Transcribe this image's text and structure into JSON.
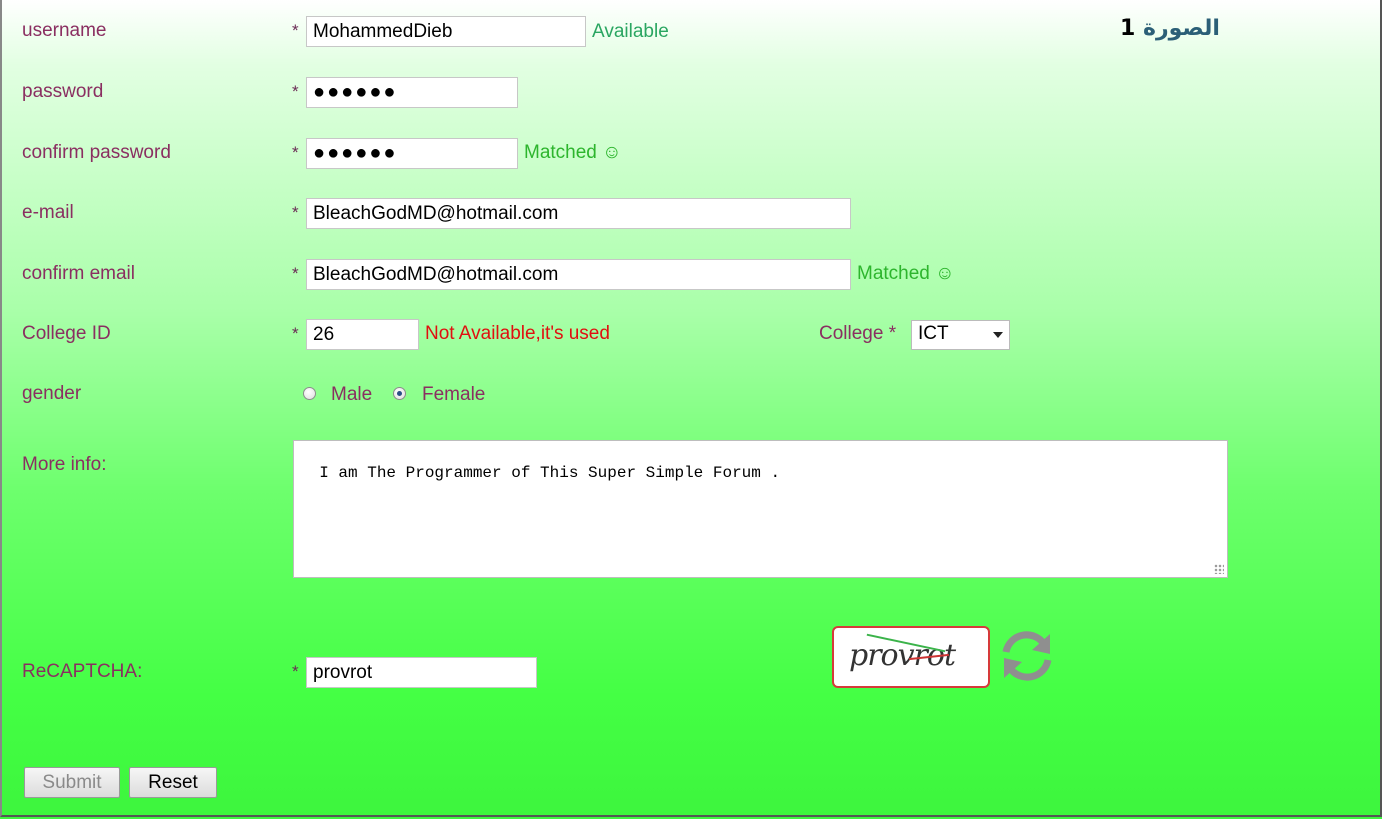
{
  "caption": {
    "text": "الصورة",
    "number": "1"
  },
  "form": {
    "username": {
      "label": "username",
      "required": "*",
      "value": "MohammedDieb",
      "status": "Available"
    },
    "password": {
      "label": "password",
      "required": "*",
      "value": "●●●●●●"
    },
    "confirm_password": {
      "label": "confirm password",
      "required": "*",
      "value": "●●●●●●",
      "status": "Matched ☺"
    },
    "email": {
      "label": "e-mail",
      "required": "*",
      "value": "BleachGodMD@hotmail.com"
    },
    "confirm_email": {
      "label": "confirm email",
      "required": "*",
      "value": "BleachGodMD@hotmail.com",
      "status": "Matched ☺"
    },
    "college_id": {
      "label": "College ID",
      "required": "*",
      "value": "26",
      "status": "Not Available,it's used"
    },
    "college": {
      "label": "College *",
      "selected": "ICT"
    },
    "gender": {
      "label": "gender",
      "options": [
        {
          "label": "Male",
          "checked": false
        },
        {
          "label": "Female",
          "checked": true
        }
      ]
    },
    "more_info": {
      "label": "More info:",
      "value": "I am The Programmer of This Super Simple Forum ."
    },
    "recaptcha": {
      "label": "ReCAPTCHA:",
      "required": "*",
      "value": "provrot",
      "image_text": "provrot"
    },
    "buttons": {
      "submit": "Submit",
      "reset": "Reset"
    }
  },
  "colors": {
    "label": "#8a2f61",
    "ok": "#2db52d",
    "error": "#e01010",
    "captcha_border": "#d63a3a"
  },
  "icons": {
    "refresh": "refresh-icon"
  }
}
